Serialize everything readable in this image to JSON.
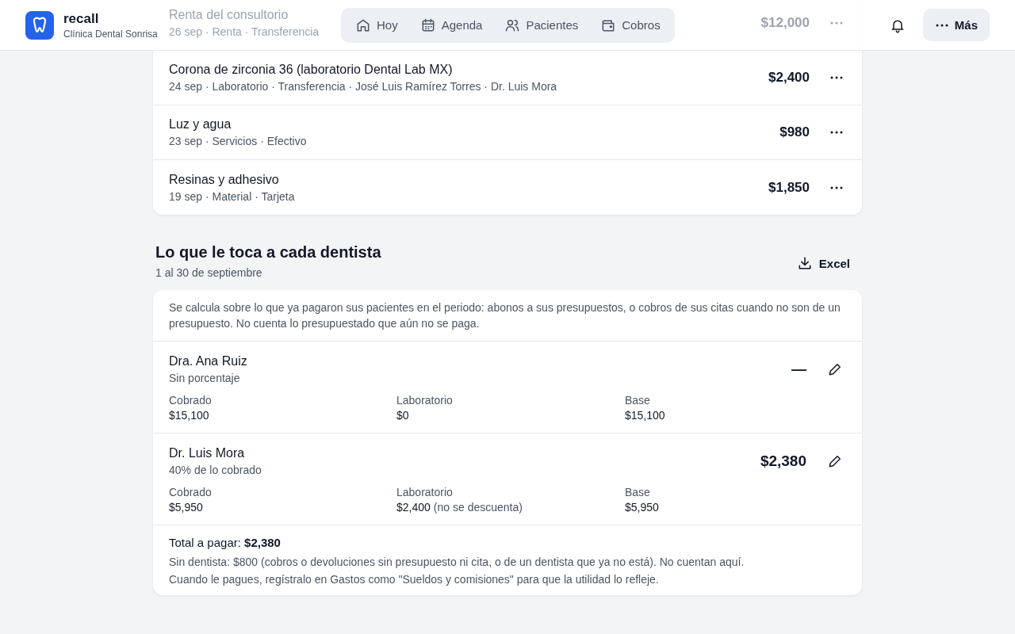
{
  "header": {
    "brand": {
      "name": "recall",
      "clinic": "Clínica Dental Sonrisa"
    },
    "nav": [
      {
        "label": "Hoy",
        "selected": false
      },
      {
        "label": "Agenda",
        "selected": false
      },
      {
        "label": "Pacientes",
        "selected": false
      },
      {
        "label": "Cobros",
        "selected": false
      }
    ],
    "more_label": "Más"
  },
  "expenses": [
    {
      "title": "Renta del consultorio",
      "meta": "26 sep · Renta · Transferencia",
      "amount": "$12,000"
    },
    {
      "title": "Corona de zirconia 36 (laboratorio Dental Lab MX)",
      "meta": "24 sep · Laboratorio · Transferencia · José Luis Ramírez Torres · Dr. Luis Mora",
      "amount": "$2,400"
    },
    {
      "title": "Luz y agua",
      "meta": "23 sep · Servicios · Efectivo",
      "amount": "$980"
    },
    {
      "title": "Resinas y adhesivo",
      "meta": "19 sep · Material · Tarjeta",
      "amount": "$1,850"
    }
  ],
  "commissions": {
    "title": "Lo que le toca a cada dentista",
    "period": "1 al 30 de septiembre",
    "export_label": "Excel",
    "note": "Se calcula sobre lo que ya pagaron sus pacientes en el periodo: abonos a sus presupuestos, o cobros de sus citas cuando no son de un presupuesto. No cuenta lo presupuestado que aún no se paga.",
    "dentists": [
      {
        "name": "Dra. Ana Ruiz",
        "rule": "Sin porcentaje",
        "amount": "—",
        "stats": [
          {
            "label": "Cobrado",
            "value": "$15,100"
          },
          {
            "label": "Laboratorio",
            "value": "$0"
          },
          {
            "label": "Base",
            "value": "$15,100"
          }
        ]
      },
      {
        "name": "Dr. Luis Mora",
        "rule": "40% de lo cobrado",
        "amount": "$2,380",
        "stats": [
          {
            "label": "Cobrado",
            "value": "$5,950"
          },
          {
            "label": "Laboratorio",
            "value": "$2,400",
            "note": "(no se descuenta)"
          },
          {
            "label": "Base",
            "value": "$5,950"
          }
        ]
      }
    ],
    "total": "Total a pagar: **$2,380**",
    "footnotes": [
      "Sin dentista: $800 (cobros o devoluciones sin presupuesto ni cita, o de un dentista que ya no está). No cuentan aquí.",
      "Cuando le pagues, regístralo en Gastos como \"Sueldos y comisiones\" para que la utilidad lo refleje."
    ]
  }
}
